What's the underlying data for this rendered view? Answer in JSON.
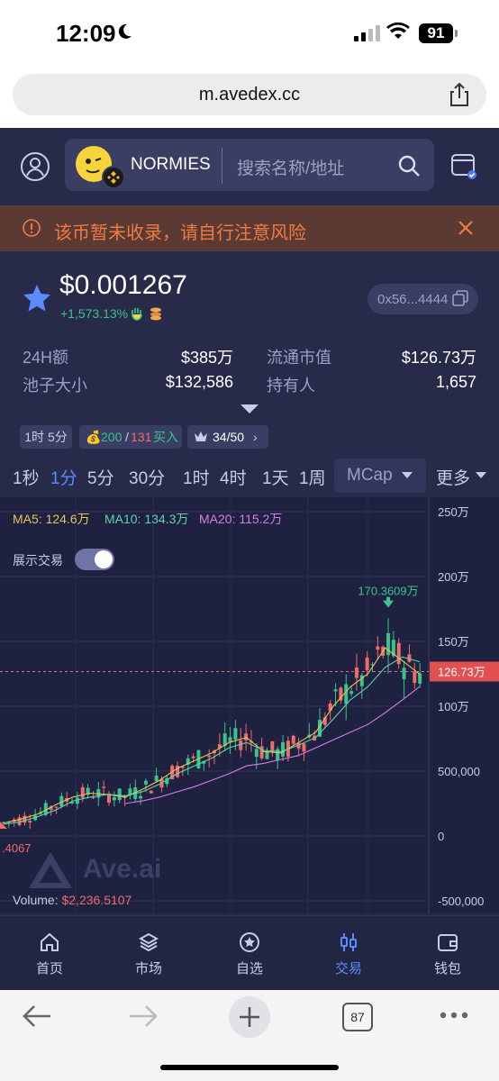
{
  "status_bar": {
    "time": "12:09",
    "battery": "91"
  },
  "browser": {
    "url": "m.avedex.cc",
    "tabs_count": "87"
  },
  "header": {
    "token_name": "NORMIES",
    "search_placeholder": "搜索名称/地址"
  },
  "warning": {
    "text": "该币暂未收录，请自行注意风险"
  },
  "token": {
    "price": "$0.001267",
    "change": "+1,573.13%",
    "address": "0x56...4444"
  },
  "stats": [
    {
      "label": "24H额",
      "value": "$385万"
    },
    {
      "label": "流通市值",
      "value": "$126.73万"
    },
    {
      "label": "池子大小",
      "value": "$132,586"
    },
    {
      "label": "持有人",
      "value": "1,657"
    }
  ],
  "tags": {
    "age": "1时 5分",
    "buy_count": "200",
    "sep": "/",
    "sell_count": "131",
    "buy_label": "买入",
    "holders_rank": "34/50"
  },
  "timeframes": [
    "1秒",
    "1分",
    "5分",
    "30分",
    "1时",
    "4时",
    "1天",
    "1周"
  ],
  "active_timeframe": "1分",
  "mcap_label": "MCap",
  "more_label": "更多",
  "chart_header": {
    "ma5": "MA5: 124.6万",
    "ma10": "MA10: 134.3万",
    "ma20": "MA20: 115.2万",
    "show_trades": "展示交易"
  },
  "chart_data": {
    "type": "line",
    "y_ticks": [
      "250万",
      "200万",
      "150万",
      "100万",
      "500,000",
      "0",
      "-500,000"
    ],
    "y_tick_values": [
      2500000,
      2000000,
      1500000,
      1000000,
      500000,
      0,
      -500000
    ],
    "ylim": [
      -500000,
      2500000
    ],
    "current_value": 1267300,
    "current_label": "126.73万",
    "high_label": "170.3609万",
    "high_value": 1703609,
    "low_label": ".4067",
    "series": [
      {
        "name": "MA5",
        "color": "#e7c45a",
        "values": [
          100000,
          130000,
          170000,
          240000,
          300000,
          330000,
          320000,
          300000,
          360000,
          430000,
          520000,
          580000,
          640000,
          720000,
          760000,
          650000,
          640000,
          720000,
          800000,
          1000000,
          1150000,
          1250000,
          1450000,
          1350000,
          1246000
        ]
      },
      {
        "name": "MA10",
        "color": "#5fd3b0",
        "values": [
          90000,
          110000,
          150000,
          200000,
          270000,
          300000,
          320000,
          310000,
          340000,
          400000,
          480000,
          540000,
          600000,
          680000,
          720000,
          660000,
          650000,
          700000,
          760000,
          900000,
          1050000,
          1150000,
          1300000,
          1380000,
          1343000
        ]
      },
      {
        "name": "MA20",
        "color": "#d77ee3",
        "values": [
          null,
          null,
          null,
          null,
          null,
          null,
          null,
          250000,
          270000,
          300000,
          340000,
          380000,
          430000,
          480000,
          540000,
          560000,
          590000,
          620000,
          680000,
          740000,
          800000,
          860000,
          950000,
          1050000,
          1152000
        ]
      }
    ],
    "volume_label": "Volume:",
    "volume_value": "$2,236.5107",
    "watermark": "Ave.ai"
  },
  "nav": [
    {
      "label": "首页",
      "icon": "home-icon"
    },
    {
      "label": "市场",
      "icon": "layers-icon"
    },
    {
      "label": "自选",
      "icon": "star-circle-icon"
    },
    {
      "label": "交易",
      "icon": "candles-icon"
    },
    {
      "label": "钱包",
      "icon": "wallet-icon"
    }
  ],
  "active_nav": "交易",
  "colors": {
    "background": "#272a48",
    "accent": "#5b8cff",
    "up": "#39c48d",
    "down": "#f06b6b",
    "warning": "#f07b42"
  }
}
